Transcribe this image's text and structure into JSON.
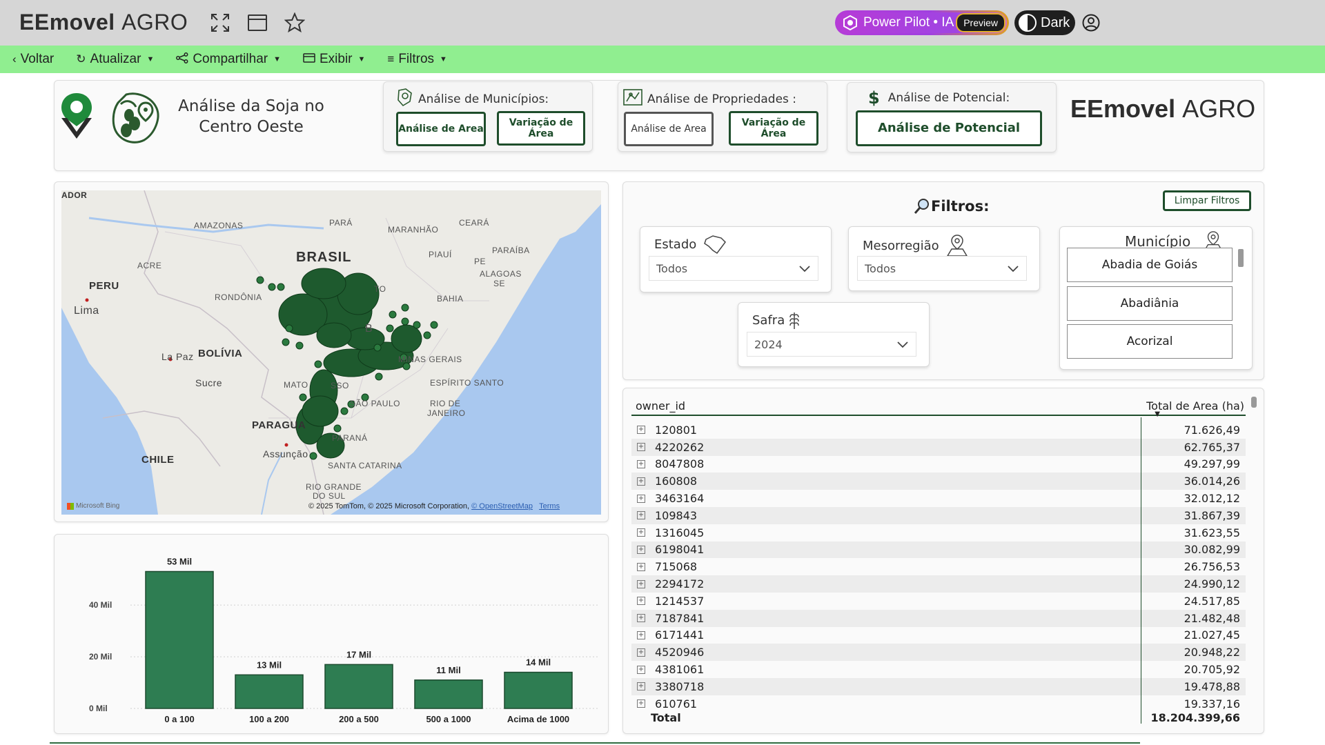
{
  "app": {
    "brand_bold": "EEmovel",
    "brand_light": "AGRO"
  },
  "topbar": {
    "pilot_label": "Power Pilot • IA",
    "pilot_badge": "Preview",
    "dark_label": "Dark"
  },
  "menu": {
    "back": "Voltar",
    "refresh": "Atualizar",
    "share": "Compartilhar",
    "view": "Exibir",
    "filters": "Filtros"
  },
  "header": {
    "title": "Análise da Soja no Centro Oeste",
    "municipios": {
      "title": "Análise de Municípios:",
      "btn_area": "Análise de Area",
      "btn_variation": "Variação de Área"
    },
    "propriedades": {
      "title": "Análise de Propriedades :",
      "btn_area": "Análise de Area",
      "btn_variation": "Variação de Área"
    },
    "potencial": {
      "title": "Análise de Potencial:",
      "btn": "Análise de Potencial"
    },
    "brand_bold": "EEmovel",
    "brand_light": "AGRO"
  },
  "map": {
    "labels": {
      "ador": "ADOR",
      "amazonas": "AMAZONAS",
      "para": "PARÁ",
      "maranhao": "MARANHÃO",
      "ceara": "CEARÁ",
      "brasil": "BRASIL",
      "piaui": "PIAUÍ",
      "paraiba": "PARAÍBA",
      "pe": "PE",
      "alagoas": "ALAGOAS",
      "se": "SE",
      "acre": "ACRE",
      "peru": "PERU",
      "rondonia": "RONDÔNIA",
      "to": "TO",
      "bahia": "BAHIA",
      "lima": "Lima",
      "bolivia": "BOLÍVIA",
      "lapaz": "La Paz",
      "minas": "MINAS GERAIS",
      "sucre": "Sucre",
      "mato": "MATO",
      "sso": "SSO",
      "espirito": "ESPÍRITO SANTO",
      "saopaulo": "SÃO PAULO",
      "riode": "RIO DE",
      "janeiro": "JANEIRO",
      "paragua": "PARAGUA",
      "parana": "PARANÁ",
      "chile": "CHILE",
      "assuncao": "Assunção",
      "santacatarina": "SANTA CATARINA",
      "riogrande": "RIO GRANDE",
      "dosul": "DO SUL",
      "ba": "B"
    },
    "bing": "Microsoft Bing",
    "attribution": "© 2025 TomTom, © 2025 Microsoft Corporation,",
    "osm": "© OpenStreetMap",
    "terms": "Terms"
  },
  "chart_data": {
    "type": "bar",
    "categories": [
      "0 a 100",
      "100 a 200",
      "200 a 500",
      "500 a 1000",
      "Acima de 1000"
    ],
    "values": [
      53000,
      13000,
      17000,
      11000,
      14000
    ],
    "data_labels": [
      "53 Mil",
      "13 Mil",
      "17 Mil",
      "11 Mil",
      "14 Mil"
    ],
    "y_ticks": [
      0,
      20000,
      40000
    ],
    "y_tick_labels": [
      "0 Mil",
      "20 Mil",
      "40 Mil"
    ],
    "ylim": [
      0,
      55000
    ],
    "color": "#2e7d52",
    "grid": true
  },
  "filters": {
    "title": "Filtros:",
    "clear": "Limpar Filtros",
    "estado": {
      "label": "Estado",
      "value": "Todos"
    },
    "meso": {
      "label": "Mesorregião",
      "value": "Todos"
    },
    "safra": {
      "label": "Safra",
      "value": "2024"
    },
    "municipio": {
      "label": "Município",
      "items": [
        "Abadia de Goiás",
        "Abadiânia",
        "Acorizal"
      ]
    }
  },
  "table": {
    "col1": "owner_id",
    "col2": "Total de Area (ha)",
    "rows": [
      {
        "id": "120801",
        "area": "71.626,49"
      },
      {
        "id": "4220262",
        "area": "62.765,37"
      },
      {
        "id": "8047808",
        "area": "49.297,99"
      },
      {
        "id": "160808",
        "area": "36.014,26"
      },
      {
        "id": "3463164",
        "area": "32.012,12"
      },
      {
        "id": "109843",
        "area": "31.867,39"
      },
      {
        "id": "1316045",
        "area": "31.623,55"
      },
      {
        "id": "6198041",
        "area": "30.082,99"
      },
      {
        "id": "715068",
        "area": "26.756,53"
      },
      {
        "id": "2294172",
        "area": "24.990,12"
      },
      {
        "id": "1214537",
        "area": "24.517,85"
      },
      {
        "id": "7187841",
        "area": "21.482,48"
      },
      {
        "id": "6171441",
        "area": "21.027,45"
      },
      {
        "id": "4520946",
        "area": "20.948,22"
      },
      {
        "id": "4381061",
        "area": "20.705,92"
      },
      {
        "id": "3380718",
        "area": "19.478,88"
      },
      {
        "id": "610761",
        "area": "19.337,16"
      }
    ],
    "total_label": "Total",
    "total_value": "18.204.399,66"
  }
}
